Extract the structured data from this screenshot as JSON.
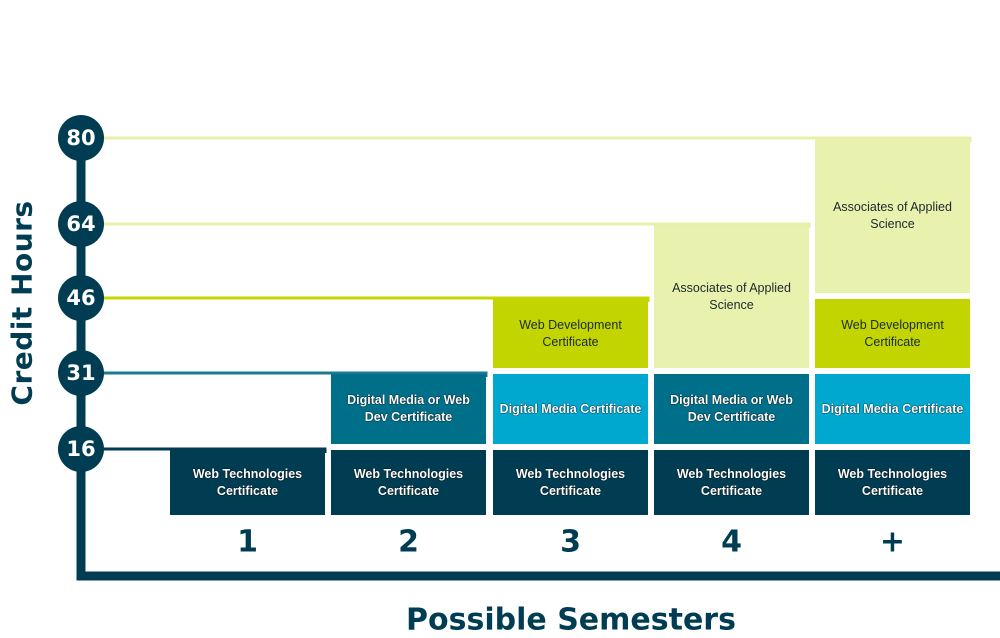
{
  "chart_data": {
    "type": "diagram",
    "title": "",
    "ylabel": "Credit Hours",
    "xlabel": "Possible Semesters",
    "y_ticks": [
      16,
      31,
      46,
      64,
      80
    ],
    "ylim": [
      0,
      80
    ],
    "categories": [
      "1",
      "2",
      "3",
      "4",
      "+"
    ],
    "gridline_colors": {
      "16": "#003d52",
      "31": "#1a7a94",
      "46": "#c5d600",
      "64": "#e8f0a8",
      "80": "#e8f0a8"
    },
    "columns": [
      {
        "semester": "1",
        "blocks": [
          {
            "label": "Web Technologies Certificate",
            "credit_hours": 16,
            "color": "#003d52",
            "style": "dark"
          }
        ]
      },
      {
        "semester": "2",
        "blocks": [
          {
            "label": "Web Technologies Certificate",
            "credit_hours": 16,
            "color": "#003d52",
            "style": "dark"
          },
          {
            "label": "Digital Media or Web Dev Certificate",
            "credit_hours": 31,
            "color": "#006f8a",
            "style": "teal"
          }
        ]
      },
      {
        "semester": "3",
        "blocks": [
          {
            "label": "Web Technologies Certificate",
            "credit_hours": 16,
            "color": "#003d52",
            "style": "dark"
          },
          {
            "label": "Digital Media Certificate",
            "credit_hours": 31,
            "color": "#00a8d0",
            "style": "cyan"
          },
          {
            "label": "Web Development Certificate",
            "credit_hours": 46,
            "color": "#c2d500",
            "style": "lime"
          }
        ]
      },
      {
        "semester": "4",
        "blocks": [
          {
            "label": "Web Technologies Certificate",
            "credit_hours": 16,
            "color": "#003d52",
            "style": "dark"
          },
          {
            "label": "Digital Media or Web Dev Certificate",
            "credit_hours": 31,
            "color": "#006f8a",
            "style": "teal"
          },
          {
            "label": "Associates of Applied Science",
            "credit_hours": 64,
            "color": "#e9f1ae",
            "style": "pale"
          }
        ]
      },
      {
        "semester": "+",
        "blocks": [
          {
            "label": "Web Technologies Certificate",
            "credit_hours": 16,
            "color": "#003d52",
            "style": "dark"
          },
          {
            "label": "Digital Media Certificate",
            "credit_hours": 31,
            "color": "#00a8d0",
            "style": "cyan"
          },
          {
            "label": "Web Development Certificate",
            "credit_hours": 46,
            "color": "#c2d500",
            "style": "lime"
          },
          {
            "label": "Associates of Applied Science",
            "credit_hours": 80,
            "color": "#e9f1ae",
            "style": "pale"
          }
        ]
      }
    ]
  },
  "axis_color": "#003d52"
}
